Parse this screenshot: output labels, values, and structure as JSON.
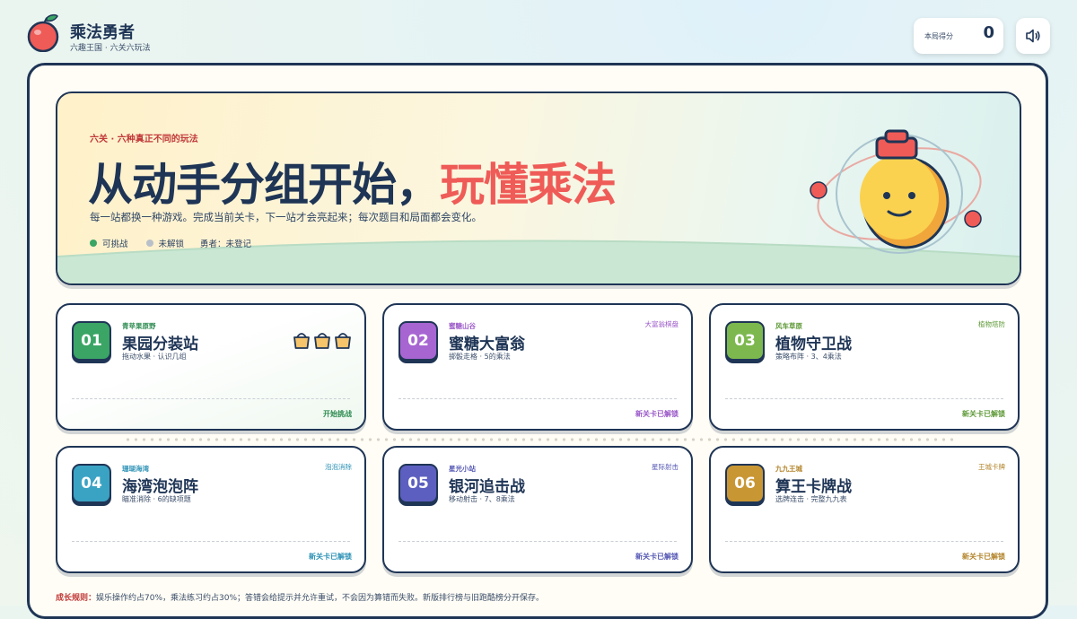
{
  "header": {
    "title": "乘法勇者",
    "subtitle": "六趣王国 · 六关六玩法",
    "score_label": "本局得分",
    "score_value": "0",
    "sound_icon": "speaker-icon"
  },
  "hero": {
    "kicker": "六关 · 六种真正不同的玩法",
    "title_main": "从动手分组开始，",
    "title_accent": "玩懂乘法",
    "description": "每一站都换一种游戏。完成当前关卡，下一站才会亮起来；每次题目和局面都会变化。",
    "legend": {
      "available": "可挑战",
      "locked": "未解锁",
      "hero_label": "勇者：未登记"
    }
  },
  "levels": [
    {
      "num": "01",
      "region": "青苹果原野",
      "title": "果园分装站",
      "sub": "拖动水果 · 认识几组",
      "tag": "",
      "status": "开始挑战",
      "color": "#3aa565",
      "accent": "#2f8c52"
    },
    {
      "num": "02",
      "region": "蜜糖山谷",
      "title": "蜜糖大富翁",
      "sub": "掷骰走格 · 5的乘法",
      "tag": "大富翁棋盘",
      "status": "新关卡已解锁",
      "color": "#a765d2",
      "accent": "#9a58c8"
    },
    {
      "num": "03",
      "region": "风车草原",
      "title": "植物守卫战",
      "sub": "策略布阵 · 3、4乘法",
      "tag": "植物塔防",
      "status": "新关卡已解锁",
      "color": "#7cb84e",
      "accent": "#5f9a38"
    },
    {
      "num": "04",
      "region": "珊瑚海湾",
      "title": "海湾泡泡阵",
      "sub": "瞄准消除 · 6的缺项题",
      "tag": "泡泡消除",
      "status": "新关卡已解锁",
      "color": "#3aa3c4",
      "accent": "#2f93b6"
    },
    {
      "num": "05",
      "region": "星光小站",
      "title": "银河追击战",
      "sub": "移动射击 · 7、8乘法",
      "tag": "星际射击",
      "status": "新关卡已解锁",
      "color": "#5c5fbf",
      "accent": "#5457b4"
    },
    {
      "num": "06",
      "region": "九九王城",
      "title": "算王卡牌战",
      "sub": "选牌连击 · 完整九九表",
      "tag": "王城卡牌",
      "status": "新关卡已解锁",
      "color": "#c99634",
      "accent": "#b3842a"
    }
  ],
  "footer": {
    "label": "成长规则：",
    "text": "娱乐操作约占70%，乘法练习约占30%；答错会给提示并允许重试，不会因为算错而失败。新版排行榜与旧跑酷榜分开保存。"
  },
  "colors": {
    "navy": "#1f3556",
    "red_accent": "#ef5b57",
    "available_dot": "#3aa565",
    "locked_dot": "#b9c0c9"
  }
}
